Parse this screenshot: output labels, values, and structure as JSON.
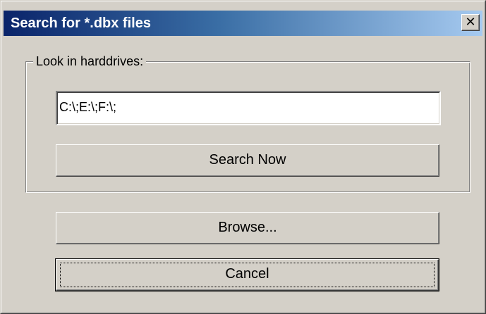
{
  "window": {
    "title": "Search for *.dbx files",
    "close_label": "✕"
  },
  "group": {
    "legend": "Look in harddrives:"
  },
  "path_input": {
    "value": "C:\\;E:\\;F:\\;"
  },
  "buttons": {
    "search_now": "Search Now",
    "browse": "Browse...",
    "cancel": "Cancel"
  },
  "colors": {
    "face": "#d4d0c8",
    "title_start": "#0a246a",
    "title_end": "#a6caf0"
  }
}
